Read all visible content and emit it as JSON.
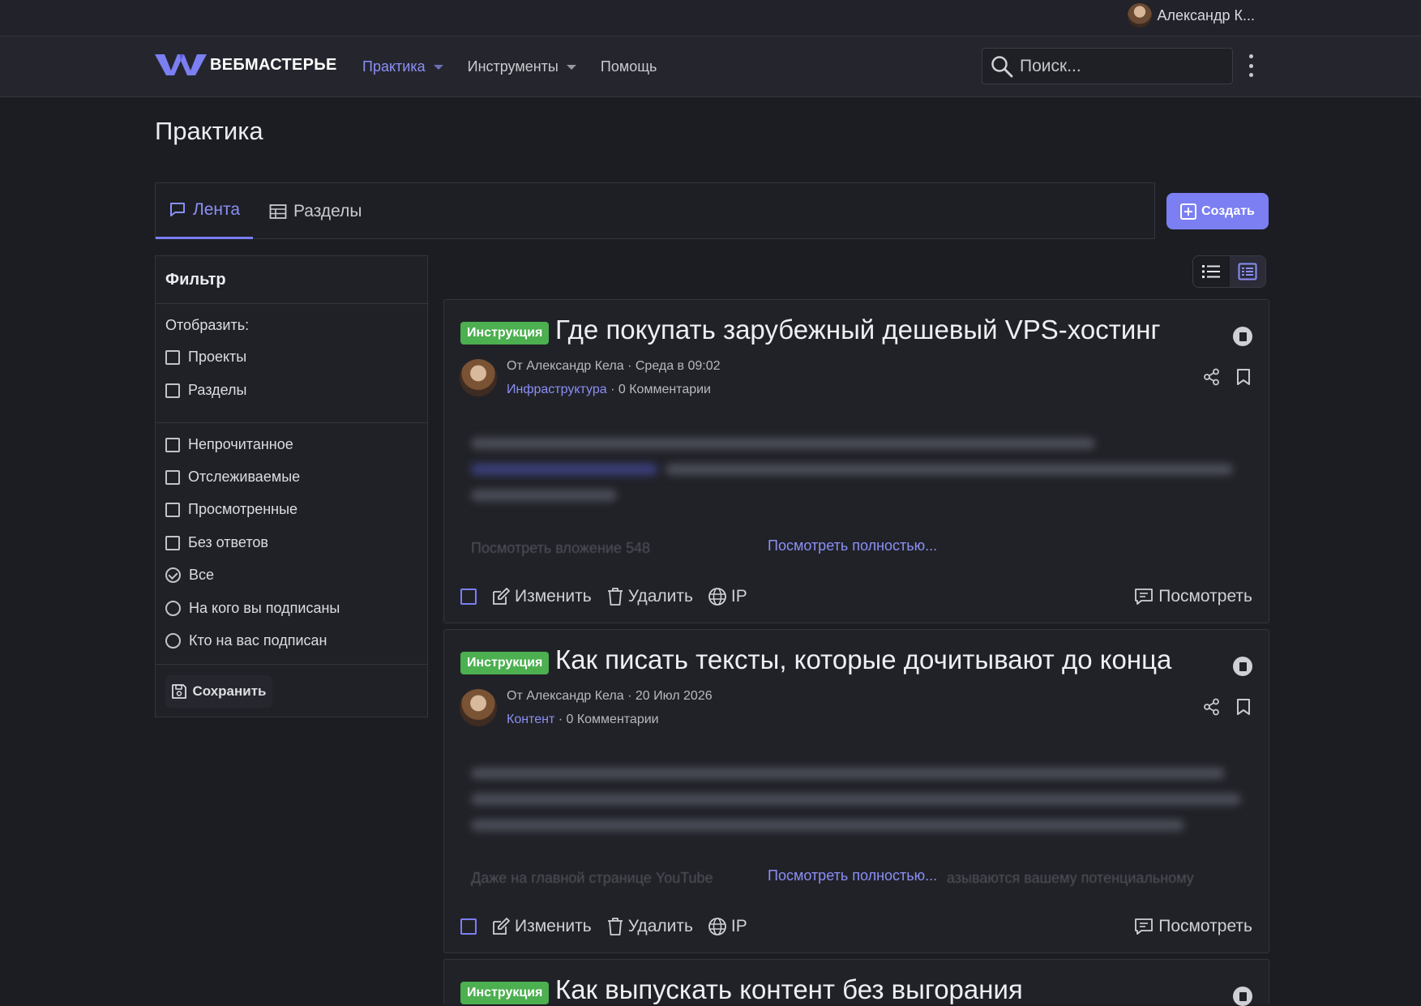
{
  "user": {
    "name": "Александр К..."
  },
  "brand": {
    "name": "ВЕБМАСТЕРЬЕ",
    "accent": "#7b7ff2"
  },
  "nav": {
    "items": [
      {
        "label": "Практика",
        "has_dropdown": true,
        "active": true
      },
      {
        "label": "Инструменты",
        "has_dropdown": true,
        "active": false
      },
      {
        "label": "Помощь",
        "has_dropdown": false,
        "active": false
      }
    ]
  },
  "search": {
    "placeholder": "Поиск..."
  },
  "page": {
    "title": "Практика"
  },
  "tabs": [
    {
      "label": "Лента",
      "icon": "chat-icon",
      "active": true
    },
    {
      "label": "Разделы",
      "icon": "table-icon",
      "active": false
    }
  ],
  "create_button": {
    "label": "Создать"
  },
  "filter": {
    "title": "Фильтр",
    "show_label": "Отобразить:",
    "group1": [
      "Проекты",
      "Разделы"
    ],
    "group2": [
      "Непрочитанное",
      "Отслеживаемые",
      "Просмотренные",
      "Без ответов"
    ],
    "radios": [
      {
        "label": "Все",
        "checked": true
      },
      {
        "label": "На кого вы подписаны",
        "checked": false
      },
      {
        "label": "Кто на вас подписан",
        "checked": false
      }
    ],
    "save_label": "Сохранить"
  },
  "posts": [
    {
      "badge": "Инструкция",
      "title": "Где покупать зарубежный дешевый VPS-хостинг",
      "author": "От Александр Кела",
      "date": "Среда в 09:02",
      "category": "Инфраструктура",
      "comments": "0 Комментарии",
      "faded_text": "Посмотреть вложение 548",
      "more_label": "Посмотреть полностью...",
      "actions": {
        "edit": "Изменить",
        "delete": "Удалить",
        "ip": "IP",
        "view": "Посмотреть"
      }
    },
    {
      "badge": "Инструкция",
      "title": "Как писать тексты, которые дочитывают до конца",
      "author": "От Александр Кела",
      "date": "20 Июл 2026",
      "category": "Контент",
      "comments": "0 Комментарии",
      "faded_text": "Даже на главной странице YouTube",
      "faded_text_right": "азываются вашему потенциальному",
      "more_label": "Посмотреть полностью...",
      "actions": {
        "edit": "Изменить",
        "delete": "Удалить",
        "ip": "IP",
        "view": "Посмотреть"
      }
    },
    {
      "badge": "Инструкция",
      "title": "Как выпускать контент без выгорания"
    }
  ]
}
